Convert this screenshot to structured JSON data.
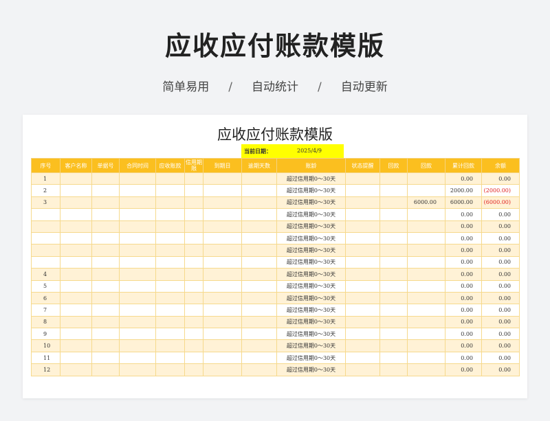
{
  "header": {
    "title": "应收应付账款模版",
    "features": [
      "简单易用",
      "自动统计",
      "自动更新"
    ],
    "separator": "/"
  },
  "sheet": {
    "title": "应收应付账款模版",
    "current_date_label": "当前日期：",
    "current_date": "2025/4/9",
    "columns": [
      "序号",
      "客户名称",
      "单据号",
      "合同时间",
      "应收账款",
      "信用期限",
      "到期日",
      "逾期天数",
      "账龄",
      "状态提醒",
      "回款",
      "回款",
      "累计回款",
      "余额"
    ],
    "rows": [
      {
        "idx": "1",
        "aging": "超过信用期0～30天",
        "payment": "",
        "cumulative": "0.00",
        "balance": "0.00",
        "negative": false
      },
      {
        "idx": "2",
        "aging": "超过信用期0～30天",
        "payment": "",
        "cumulative": "2000.00",
        "balance": "(2000.00)",
        "negative": true
      },
      {
        "idx": "3",
        "aging": "超过信用期0～30天",
        "payment": "6000.00",
        "cumulative": "6000.00",
        "balance": "(6000.00)",
        "negative": true
      },
      {
        "idx": "",
        "aging": "超过信用期0～30天",
        "payment": "",
        "cumulative": "0.00",
        "balance": "0.00",
        "negative": false
      },
      {
        "idx": "",
        "aging": "超过信用期0～30天",
        "payment": "",
        "cumulative": "0.00",
        "balance": "0.00",
        "negative": false
      },
      {
        "idx": "",
        "aging": "超过信用期0～30天",
        "payment": "",
        "cumulative": "0.00",
        "balance": "0.00",
        "negative": false
      },
      {
        "idx": "",
        "aging": "超过信用期0～30天",
        "payment": "",
        "cumulative": "0.00",
        "balance": "0.00",
        "negative": false
      },
      {
        "idx": "",
        "aging": "超过信用期0～30天",
        "payment": "",
        "cumulative": "0.00",
        "balance": "0.00",
        "negative": false
      },
      {
        "idx": "4",
        "aging": "超过信用期0～30天",
        "payment": "",
        "cumulative": "0.00",
        "balance": "0.00",
        "negative": false
      },
      {
        "idx": "5",
        "aging": "超过信用期0～30天",
        "payment": "",
        "cumulative": "0.00",
        "balance": "0.00",
        "negative": false
      },
      {
        "idx": "6",
        "aging": "超过信用期0～30天",
        "payment": "",
        "cumulative": "0.00",
        "balance": "0.00",
        "negative": false
      },
      {
        "idx": "7",
        "aging": "超过信用期0～30天",
        "payment": "",
        "cumulative": "0.00",
        "balance": "0.00",
        "negative": false
      },
      {
        "idx": "8",
        "aging": "超过信用期0～30天",
        "payment": "",
        "cumulative": "0.00",
        "balance": "0.00",
        "negative": false
      },
      {
        "idx": "9",
        "aging": "超过信用期0～30天",
        "payment": "",
        "cumulative": "0.00",
        "balance": "0.00",
        "negative": false
      },
      {
        "idx": "10",
        "aging": "超过信用期0～30天",
        "payment": "",
        "cumulative": "0.00",
        "balance": "0.00",
        "negative": false
      },
      {
        "idx": "11",
        "aging": "超过信用期0～30天",
        "payment": "",
        "cumulative": "0.00",
        "balance": "0.00",
        "negative": false
      },
      {
        "idx": "12",
        "aging": "超过信用期0～30天",
        "payment": "",
        "cumulative": "0.00",
        "balance": "0.00",
        "negative": false
      }
    ]
  },
  "colors": {
    "header_fill": "#fbbf1f",
    "band_fill": "#fff2d6",
    "date_highlight": "#ffff00",
    "negative_text": "#e02020"
  }
}
